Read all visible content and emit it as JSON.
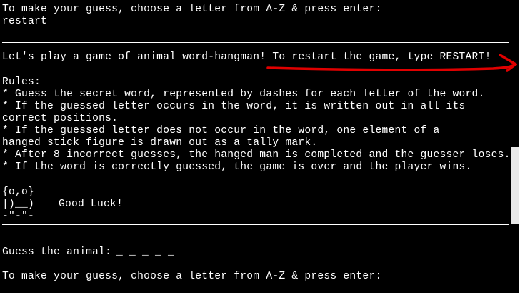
{
  "terminal": {
    "prompt_top": "To make your guess, choose a letter from A-Z & press enter:",
    "user_input": "restart",
    "welcome": "Let's play a game of animal word-hangman! To restart the game, type RESTART!",
    "rules_heading": "Rules:",
    "rules": [
      "* Guess the secret word, represented by dashes for each letter of the word.",
      "* If the guessed letter occurs in the word, it is written out in all its",
      "correct positions.",
      "* If the guessed letter does not occur in the word, one element of a",
      "hanged stick figure is drawn out as a tally mark.",
      "* After 8 incorrect guesses, the hanged man is completed and the guesser loses.",
      "* If the word is correctly guessed, the game is over and the player wins."
    ],
    "owl_art": {
      "line1": "{o,o}",
      "line2": "|)__)",
      "line3": "-\"-\"-"
    },
    "good_luck": "Good Luck!",
    "guess_label": "Guess the animal:",
    "word_blanks": "_ _ _ _ _",
    "prompt_bottom": "To make your guess, choose a letter from A-Z & press enter:"
  },
  "colors": {
    "background": "#000000",
    "text": "#ffffff",
    "annotation": "#e00000"
  }
}
